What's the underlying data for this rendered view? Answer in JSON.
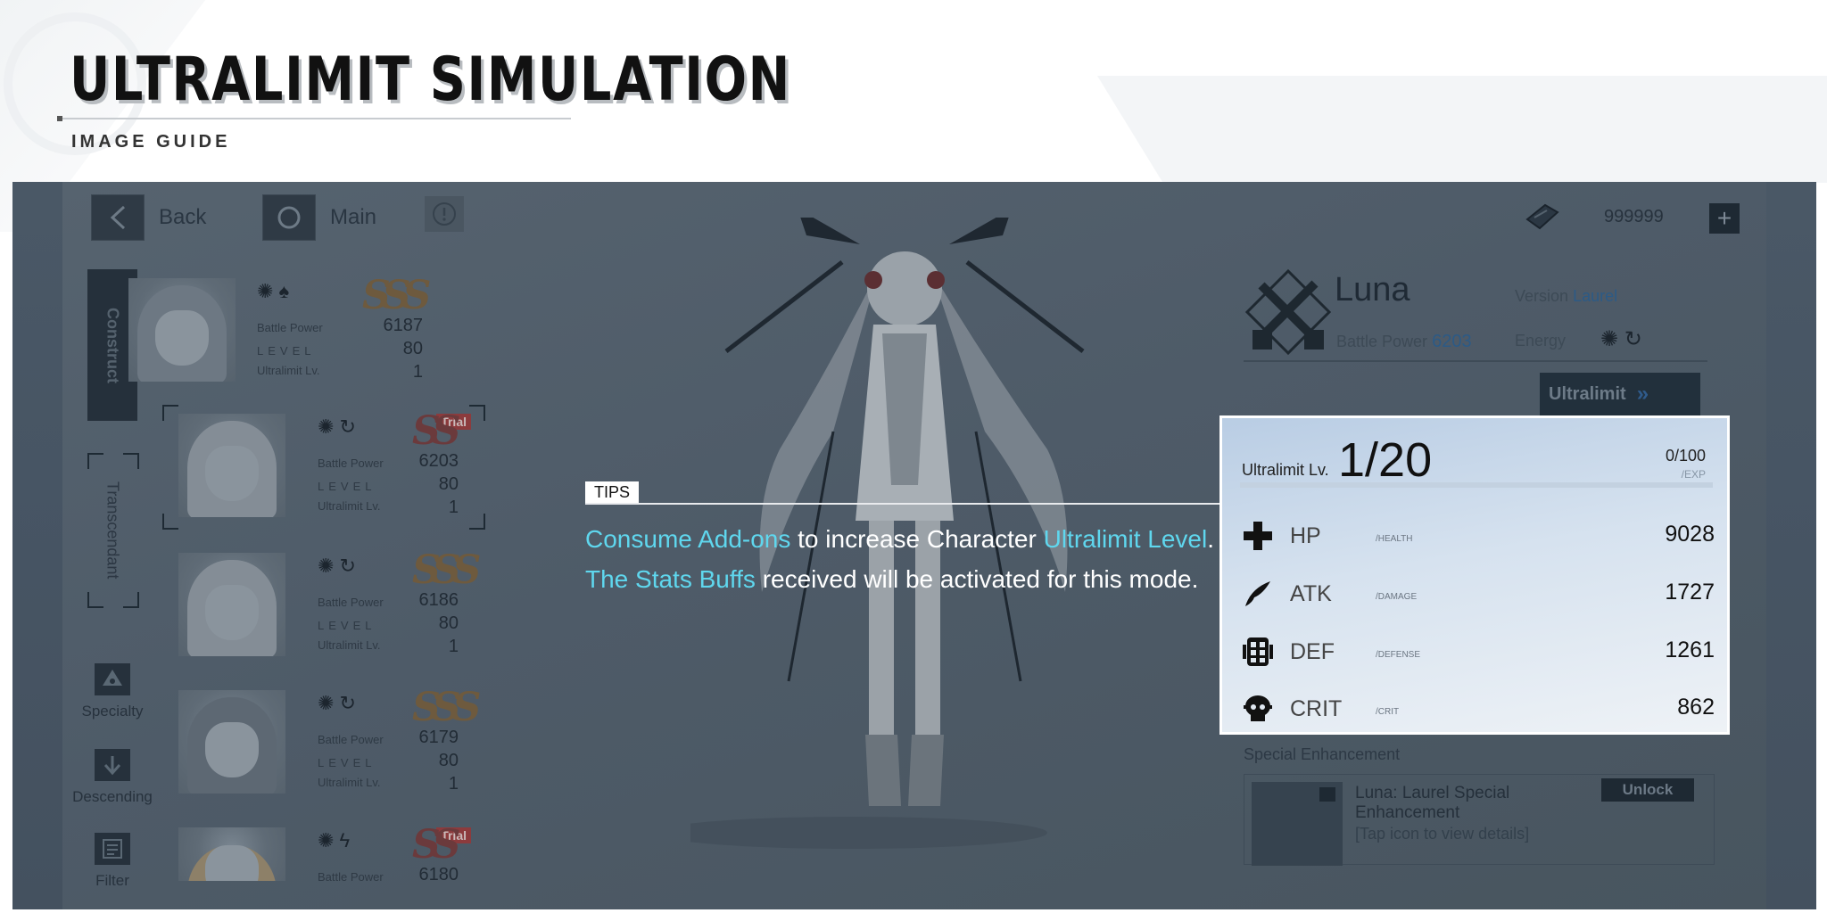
{
  "header": {
    "title": "ULTRALIMIT SIMULATION",
    "subtitle": "IMAGE GUIDE"
  },
  "topbar": {
    "back_label": "Back",
    "main_label": "Main",
    "currency_value": "999999",
    "plus_label": "+"
  },
  "sidebar": {
    "tab_construct": "Construct",
    "tab_transcendant": "Transcendant",
    "specialty_label": "Specialty",
    "descending_label": "Descending",
    "filter_label": "Filter"
  },
  "roster": {
    "battle_power_label": "Battle Power",
    "level_label": "LEVEL",
    "ultralimit_label": "Ultralimit Lv.",
    "trial_label": "Trial",
    "cards": [
      {
        "rank": "SSS",
        "battle_power": "6187",
        "level": "80",
        "ultralimit": "1"
      },
      {
        "rank": "SS",
        "battle_power": "6203",
        "level": "80",
        "ultralimit": "1",
        "trial": true
      },
      {
        "rank": "SSS",
        "battle_power": "6186",
        "level": "80",
        "ultralimit": "1"
      },
      {
        "rank": "SSS",
        "battle_power": "6179",
        "level": "80",
        "ultralimit": "1"
      },
      {
        "rank": "SS",
        "battle_power": "6180",
        "trial": true
      }
    ]
  },
  "character": {
    "name": "Luna",
    "version_label": "Version",
    "version_value": "Laurel",
    "battle_power_label": "Battle Power",
    "battle_power_value": "6203",
    "energy_label": "Energy",
    "ultralimit_button": "Ultralimit"
  },
  "panel": {
    "level_label": "Ultralimit Lv.",
    "level_value": "1/20",
    "exp_value": "0/100",
    "exp_sub": "/EXP",
    "stats": [
      {
        "name": "HP",
        "sub": "/HEALTH",
        "value": "9028",
        "icon": "cross-icon"
      },
      {
        "name": "ATK",
        "sub": "/DAMAGE",
        "value": "1727",
        "icon": "blade-icon"
      },
      {
        "name": "DEF",
        "sub": "/DEFENSE",
        "value": "1261",
        "icon": "shield-grid-icon"
      },
      {
        "name": "CRIT",
        "sub": "/CRIT",
        "value": "862",
        "icon": "skull-icon"
      }
    ]
  },
  "special": {
    "section_label": "Special Enhancement",
    "title": "Luna: Laurel Special Enhancement",
    "hint": "[Tap icon to view details]",
    "unlock_label": "Unlock"
  },
  "tips": {
    "tag": "TIPS",
    "line1_hl1": "Consume Add-ons",
    "line1_mid": " to increase Character ",
    "line1_hl2": "Ultralimit Level",
    "line1_end": ".",
    "line2_hl": "The Stats Buffs",
    "line2_rest": " received will be activated for this mode."
  },
  "colors": {
    "highlight": "#5fd7ee",
    "panel_bg": "#d6e2ef",
    "frame_bg": "#4e5b68"
  }
}
